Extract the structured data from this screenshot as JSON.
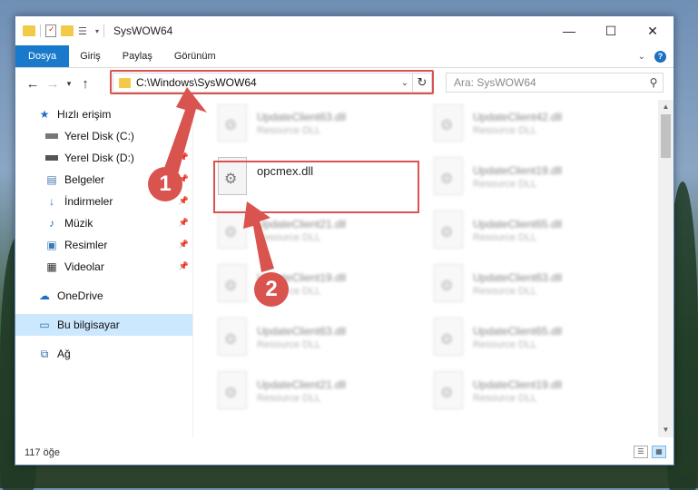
{
  "window": {
    "title": "SysWOW64",
    "controls": {
      "minimize": "—",
      "maximize": "☐",
      "close": "✕"
    }
  },
  "ribbon": {
    "tabs": [
      {
        "label": "Dosya",
        "active": true
      },
      {
        "label": "Giriş"
      },
      {
        "label": "Paylaş"
      },
      {
        "label": "Görünüm"
      }
    ],
    "chevron": "⌄"
  },
  "address": {
    "path": "C:\\Windows\\SysWOW64",
    "search_placeholder": "Ara: SysWOW64"
  },
  "sidebar": {
    "quick_access": "Hızlı erişim",
    "items": [
      {
        "label": "Yerel Disk (C:)",
        "icon": "drive-icon",
        "pinned": true
      },
      {
        "label": "Yerel Disk (D:)",
        "icon": "drive-icon",
        "pinned": true
      },
      {
        "label": "Belgeler",
        "icon": "documents-icon",
        "pinned": true
      },
      {
        "label": "İndirmeler",
        "icon": "downloads-icon",
        "pinned": true
      },
      {
        "label": "Müzik",
        "icon": "music-icon",
        "pinned": true
      },
      {
        "label": "Resimler",
        "icon": "pictures-icon",
        "pinned": true
      },
      {
        "label": "Videolar",
        "icon": "videos-icon",
        "pinned": true
      }
    ],
    "onedrive": "OneDrive",
    "this_pc": "Bu bilgisayar",
    "network": "Ağ"
  },
  "files": {
    "highlighted": {
      "name": "opcmex.dll",
      "description": ""
    },
    "blurred": [
      {
        "name": "UpdateClient63.dll",
        "description": "Resource DLL"
      },
      {
        "name": "UpdateClient42.dll",
        "description": "Resource DLL"
      },
      {
        "name": "UpdateClient19.dll",
        "description": "Resource DLL"
      },
      {
        "name": "UpdateClient21.dll",
        "description": "Resource DLL"
      },
      {
        "name": "UpdateClient65.dll",
        "description": "Resource DLL"
      },
      {
        "name": "UpdateClient19.dll",
        "description": "Resource DLL"
      },
      {
        "name": "UpdateClient63.dll",
        "description": "Resource DLL"
      },
      {
        "name": "UpdateClient63.dll",
        "description": "Resource DLL"
      },
      {
        "name": "UpdateClient65.dll",
        "description": "Resource DLL"
      },
      {
        "name": "UpdateClient21.dll",
        "description": "Resource DLL"
      },
      {
        "name": "UpdateClient19.dll",
        "description": "Resource DLL"
      }
    ]
  },
  "status": {
    "count": "117 öğe"
  },
  "annotations": {
    "step1": "1",
    "step2": "2",
    "color": "#d9534f"
  }
}
